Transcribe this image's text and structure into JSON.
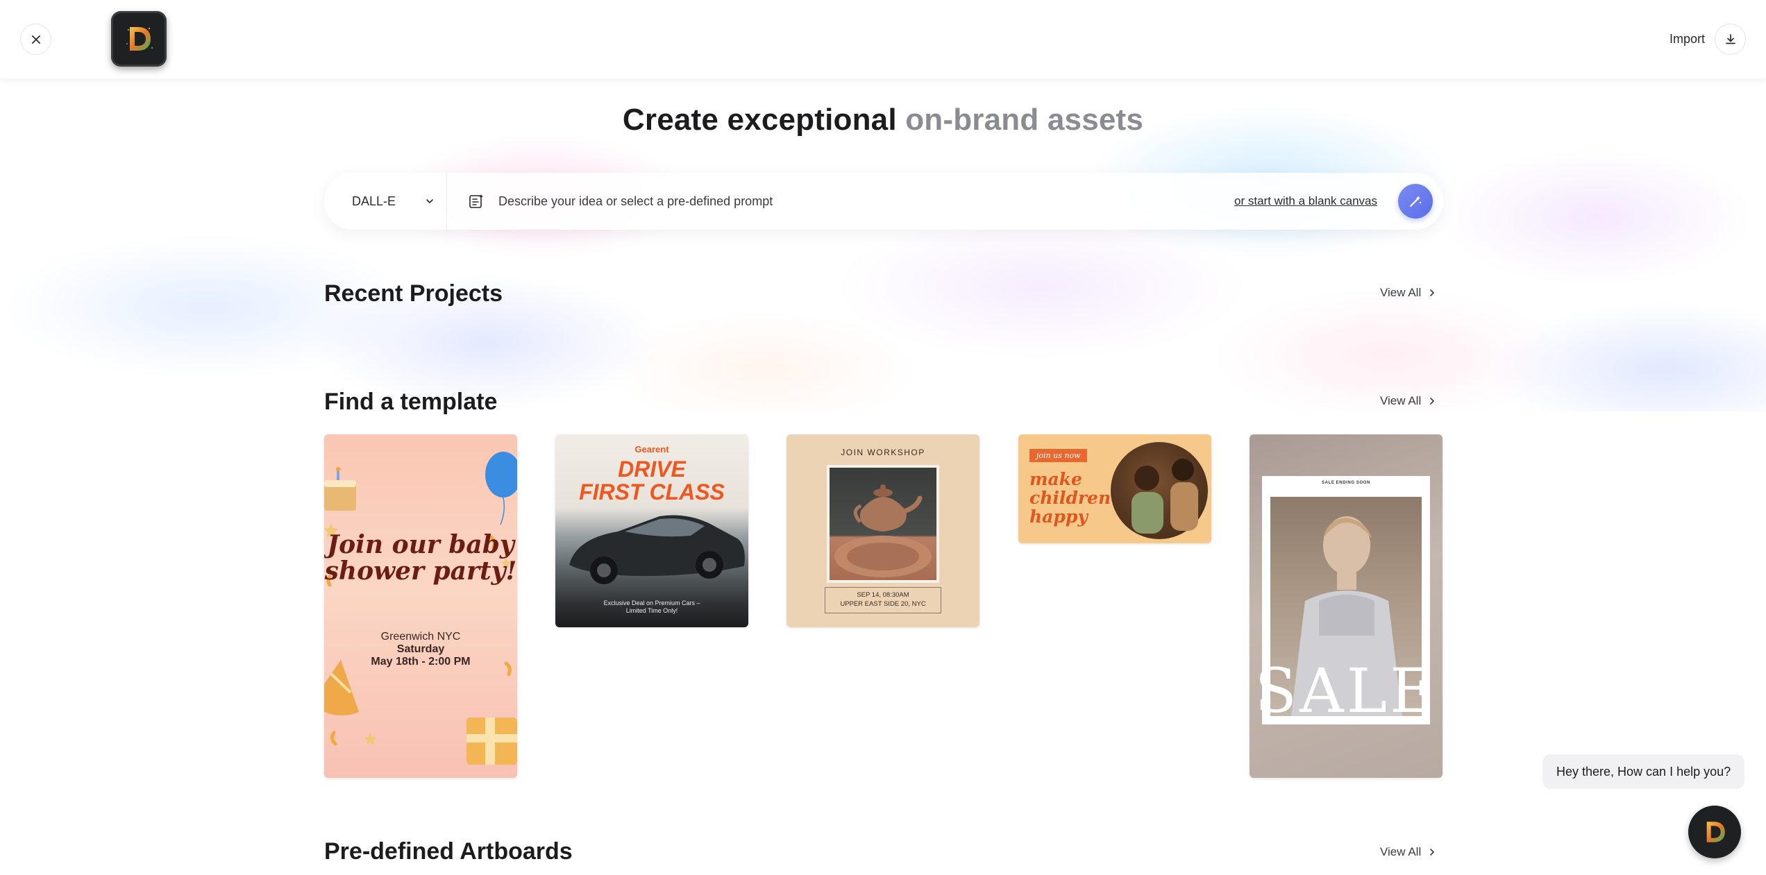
{
  "header": {
    "close_icon": "close-icon",
    "logo_icon": "d-logo-icon",
    "import_label": "Import",
    "import_icon": "download-icon"
  },
  "hero": {
    "title_main": "Create exceptional",
    "title_muted": "on-brand assets"
  },
  "prompt": {
    "model_label": "DALL-E",
    "placeholder": "Describe your idea or select a pre-defined prompt",
    "blank_canvas_link": "or start with a blank canvas",
    "submit_icon": "magic-wand-icon"
  },
  "sections": {
    "recent": {
      "title": "Recent Projects",
      "view_all": "View All"
    },
    "templates": {
      "title": "Find a template",
      "view_all": "View All"
    },
    "artboards": {
      "title": "Pre-defined Artboards",
      "view_all": "View All"
    }
  },
  "templates": {
    "baby_shower": {
      "headline": "Join our baby shower party!",
      "location": "Greenwich NYC",
      "day": "Saturday",
      "datetime": "May 18th - 2:00 PM"
    },
    "car": {
      "brand": "Gearent",
      "headline_line1": "DRIVE",
      "headline_line2": "FIRST CLASS",
      "footer_line1": "Exclusive Deal on Premium Cars –",
      "footer_line2": "Limited Time Only!"
    },
    "workshop": {
      "heading": "JOIN WORKSHOP",
      "date": "SEP 14, 08:30AM",
      "place": "UPPER EAST SIDE 20, NYC"
    },
    "children": {
      "tag": "join us now",
      "line1": "make",
      "line2": "children",
      "line3": "happy"
    },
    "sale": {
      "label": "SALE ENDING SOON",
      "word": "SALE"
    }
  },
  "chat": {
    "message": "Hey there, How can I help you?",
    "avatar_icon": "d-logo-icon"
  },
  "colors": {
    "accent": "#5b6ee8",
    "muted_title": "#8b8b92",
    "text": "#1c1c1f"
  }
}
